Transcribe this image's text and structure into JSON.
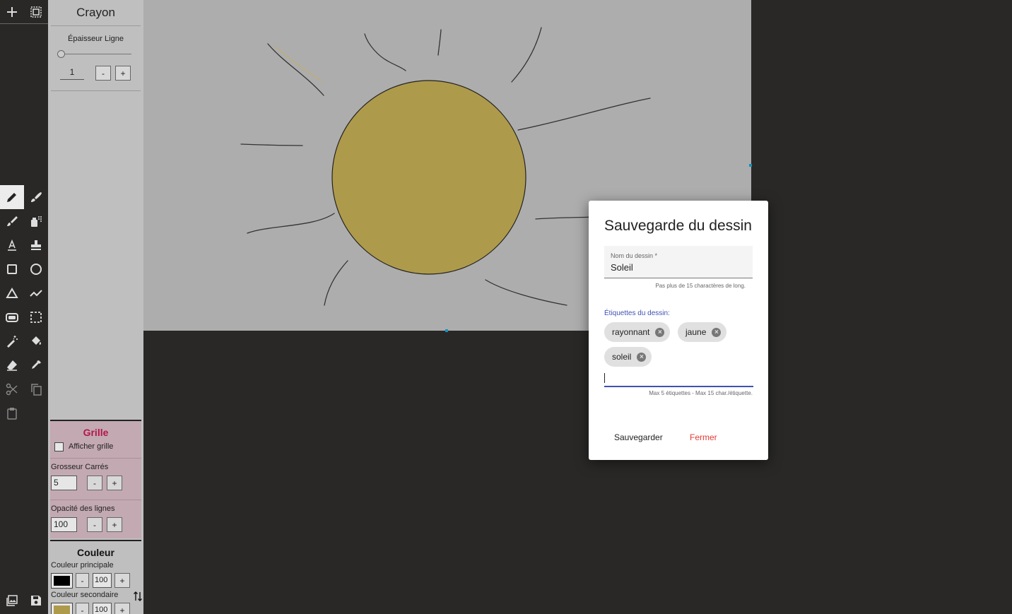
{
  "toolbar": {
    "top_tools": [
      "new-drawing-icon",
      "select-all-icon"
    ],
    "tools": [
      "pencil-icon",
      "brush-icon",
      "paint-brush-icon",
      "spray-icon",
      "text-icon",
      "stamp-icon",
      "rectangle-icon",
      "ellipse-icon",
      "triangle-icon",
      "polyline-icon",
      "rounded-rectangle-icon",
      "rectangle-select-icon",
      "magic-wand-icon",
      "paint-bucket-icon",
      "eraser-icon",
      "eyedropper-icon",
      "scissors-icon",
      "copy-icon",
      "paste-icon"
    ],
    "bottom_tools": [
      "gallery-icon",
      "save-icon"
    ],
    "active_tool": "pencil-icon"
  },
  "panel": {
    "title": "Crayon",
    "line_width_label": "Épaisseur Ligne",
    "line_width_value": "1",
    "minus": "-",
    "plus": "+"
  },
  "grid": {
    "title": "Grille",
    "show_grid_label": "Afficher grille",
    "square_size_label": "Grosseur Carrés",
    "square_size_value": "5",
    "line_opacity_label": "Opacité des lignes",
    "line_opacity_value": "100"
  },
  "color": {
    "title": "Couleur",
    "primary_label": "Couleur principale",
    "primary_color": "#000000",
    "primary_opacity": "100",
    "secondary_label": "Couleur secondaire",
    "secondary_color": "#ae9a4b",
    "secondary_opacity": "100"
  },
  "canvas": {
    "background": "#adadad",
    "sun_fill": "#ae9a4b"
  },
  "dialog": {
    "title": "Sauvegarde du dessin",
    "name_label": "Nom du dessin *",
    "name_value": "Soleil",
    "name_hint": "Pas plus de 15 charactères de long.",
    "tags_label": "Étiquettes du dessin:",
    "tags": [
      "rayonnant",
      "jaune",
      "soleil"
    ],
    "tag_input_value": "",
    "tags_hint": "Max 5 étiquettes - Max 15 char./étiquette.",
    "save_label": "Sauvegarder",
    "close_label": "Fermer",
    "accent": "#3f51b5",
    "danger": "#e53935"
  }
}
